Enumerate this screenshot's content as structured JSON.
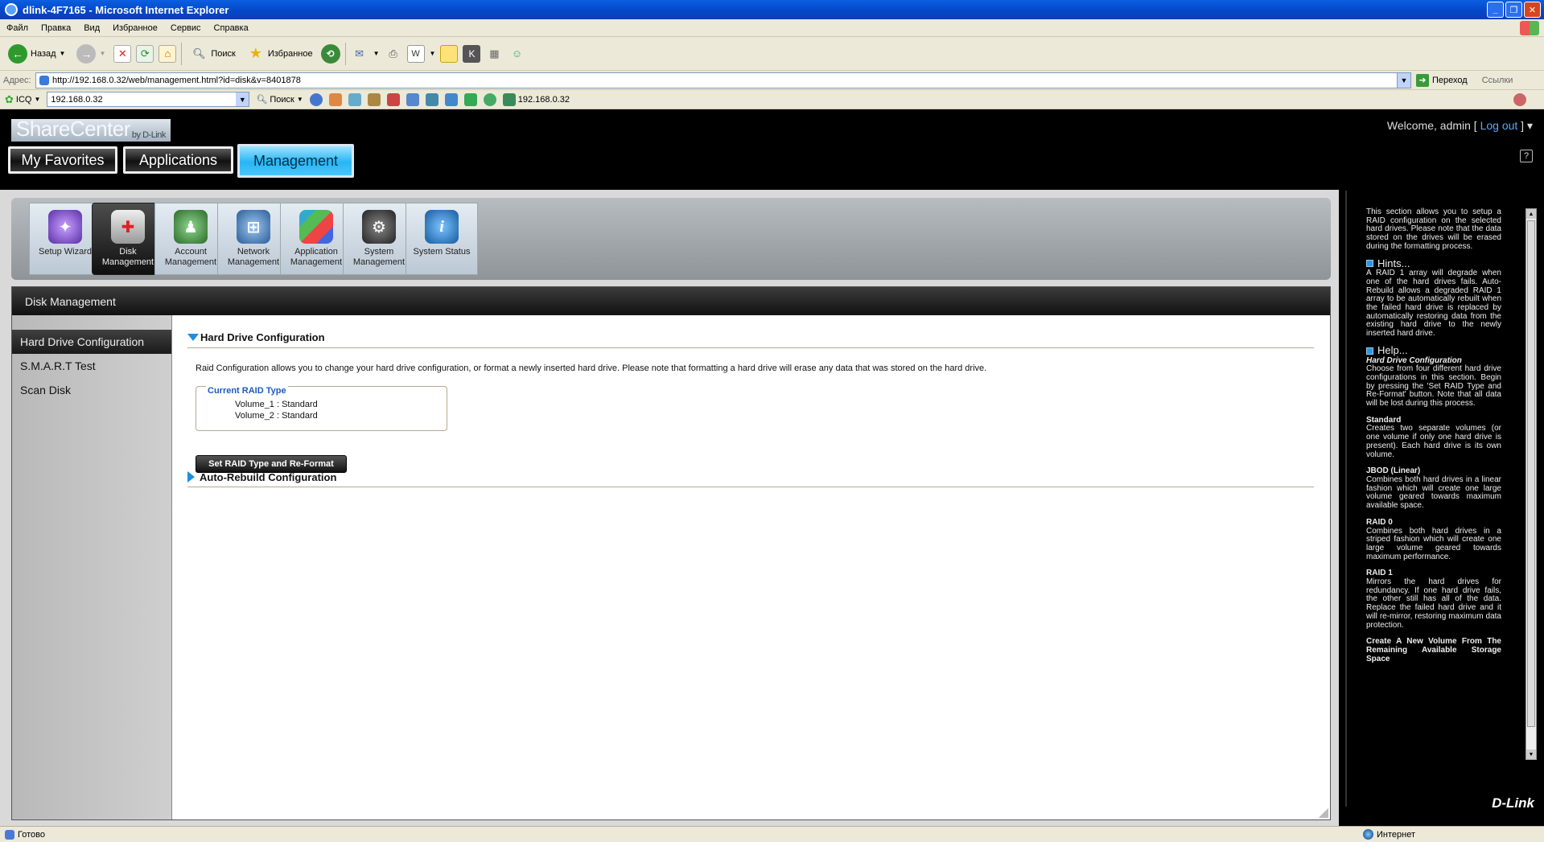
{
  "window": {
    "title": "dlink-4F7165 - Microsoft Internet Explorer"
  },
  "menu": [
    "Файл",
    "Правка",
    "Вид",
    "Избранное",
    "Сервис",
    "Справка"
  ],
  "toolbar": {
    "back": "Назад",
    "search": "Поиск",
    "favorites": "Избранное"
  },
  "address": {
    "label": "Адрес:",
    "url": "http://192.168.0.32/web/management.html?id=disk&v=8401878",
    "go": "Переход",
    "links": "Ссылки"
  },
  "icq": {
    "label": "ICQ",
    "field": "192.168.0.32",
    "search": "Поиск",
    "ip": "192.168.0.32"
  },
  "header": {
    "logo": "ShareCenter",
    "logo_sub": "by D-Link",
    "welcome": "Welcome, admin [ ",
    "logout": "Log out",
    "welcome_end": " ] ▾",
    "help": "?"
  },
  "nav_tabs": [
    "My Favorites",
    "Applications",
    "Management"
  ],
  "mgmt_icons": [
    {
      "line1": "Setup Wizard",
      "line2": ""
    },
    {
      "line1": "Disk",
      "line2": "Management"
    },
    {
      "line1": "Account",
      "line2": "Management"
    },
    {
      "line1": "Network",
      "line2": "Management"
    },
    {
      "line1": "Application",
      "line2": "Management"
    },
    {
      "line1": "System",
      "line2": "Management"
    },
    {
      "line1": "System Status",
      "line2": ""
    }
  ],
  "panel": {
    "title": "Disk Management",
    "sidebar": [
      "Hard Drive Configuration",
      "S.M.A.R.T Test",
      "Scan Disk"
    ],
    "section1": "Hard Drive Configuration",
    "description": "Raid Configuration allows you to change your hard drive configuration, or format a newly inserted hard drive. Please note that formatting a hard drive will erase any data that was stored on the hard drive.",
    "raid_title": "Current RAID Type",
    "volumes": [
      "Volume_1 : Standard",
      "Volume_2 : Standard"
    ],
    "button": "Set RAID Type and Re-Format",
    "section2": "Auto-Rebuild Configuration"
  },
  "help": {
    "intro": "This section allows you to setup a RAID configuration on the selected hard drives. Please note that the data stored on the drives will be erased during the formatting process.",
    "hints_title": "Hints...",
    "hints": "A RAID 1 array will degrade when one of the hard drives fails. Auto-Rebuild allows a degraded RAID 1 array to be automatically rebuilt when the failed hard drive is replaced by automatically restoring data from the existing hard drive to the newly inserted hard drive.",
    "help_title": "Help...",
    "hdc_title": "Hard Drive Configuration",
    "hdc": "Choose from four different hard drive configurations in this section. Begin by pressing the 'Set RAID Type and Re-Format' button. Note that all data will be lost during this process.",
    "standard_title": "Standard",
    "standard": "Creates two separate volumes (or one volume if only one hard drive is present). Each hard drive is its own volume.",
    "jbod_title": "JBOD (Linear)",
    "jbod": "Combines both hard drives in a linear fashion which will create one large volume geared towards maximum available space.",
    "raid0_title": "RAID 0",
    "raid0": "Combines both hard drives in a striped fashion which will create one large volume geared towards maximum performance.",
    "raid1_title": "RAID 1",
    "raid1": "Mirrors the hard drives for redundancy. If one hard drive fails, the other still has all of the data. Replace the failed hard drive and it will re-mirror, restoring maximum data protection.",
    "create_title": "Create A New Volume From The Remaining Available Storage Space",
    "brand": "D-Link"
  },
  "status": {
    "ready": "Готово",
    "zone": "Интернет"
  }
}
